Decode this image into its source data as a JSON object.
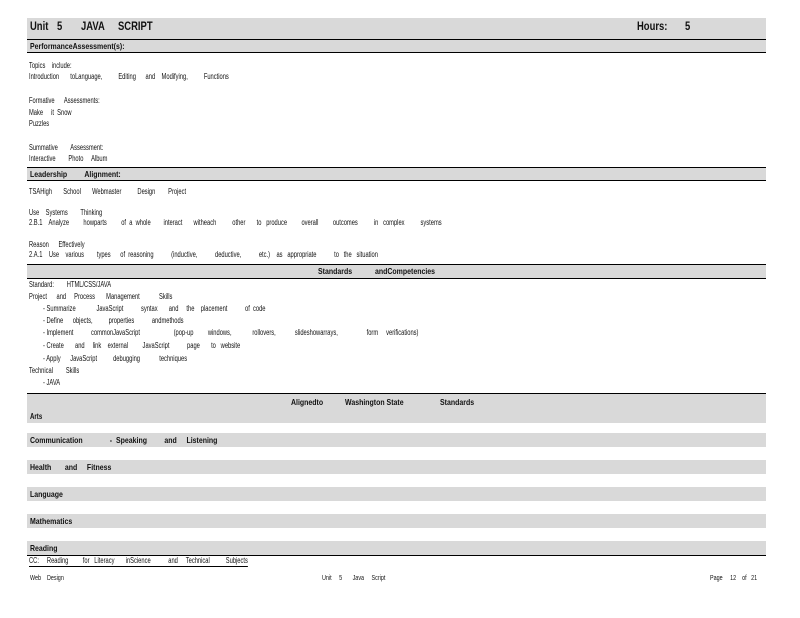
{
  "header": {
    "unit_label": "Unit",
    "unit_number": "5",
    "unit_title_1": "JAVA",
    "unit_title_2": "SCRIPT",
    "hours_label": "Hours:",
    "hours_value": "5"
  },
  "performance": {
    "heading": "PerformanceAssessment(s):",
    "topics_label": "Topics    include:",
    "topics_line": "Introduction       toLanguage,          Editing      and    Modifying,          Functions",
    "formative_label": "Formative      Assessments:",
    "formative_items": [
      "Make     it  Snow",
      "Puzzles"
    ],
    "summative_label": "Summative        Assessment:",
    "summative_item": "Interactive        Photo     Album"
  },
  "leadership": {
    "heading": "Leadership         Alignment:",
    "tsa_line": "TSAHigh       School       Webmaster          Design        Project",
    "systems_label": "Use    Systems        Thinking",
    "systems_line": "2.B.1    Analyze         howparts         of  a  whole        interact       witheach          other       to   produce         overall         outcomes          in   complex          systems",
    "reason_label": "Reason      Effectively",
    "reason_line": "2.A.1    Use    various        types      of  reasoning           (inductive,           deductive,           etc.)    as   appropriate           to   the   situation"
  },
  "standards": {
    "heading_1": "Standards",
    "heading_2": "andCompetencies",
    "standard_line": "Standard:        HTML/CSS/JAVA",
    "project_label": "Project      and     Process       Management            Skills",
    "project_items": [
      "- Summarize             JavaScript           syntax       and     the    placement           of  code",
      "- Define      objects,          properties           andmethods",
      "- Implement           commonJavaScript                     (pop-up         windows,             rollovers,            slideshowarrays,                  form     verifications)",
      "- Create       and     link    external         JavaScript           page       to   website",
      "- Apply      JavaScript          debugging            techniques"
    ],
    "technical_label": "Technical        Skills",
    "technical_items": [
      "- JAVA"
    ]
  },
  "aligned": {
    "part_1": "Alignedto",
    "part_2": "Washington State",
    "part_3": "Standards",
    "arts": "Arts",
    "communication": "Communication              -  Speaking         and     Listening",
    "health": "Health       and     Fitness",
    "language": "Language",
    "mathematics": "Mathematics",
    "reading": "Reading",
    "cc_line": "CC:     Reading         for   Literacy       inScience           and     Technical          Subjects"
  },
  "footer": {
    "left": "Web    Design",
    "center": "Unit     5       Java     Script",
    "right": "Page     12    of   21"
  }
}
